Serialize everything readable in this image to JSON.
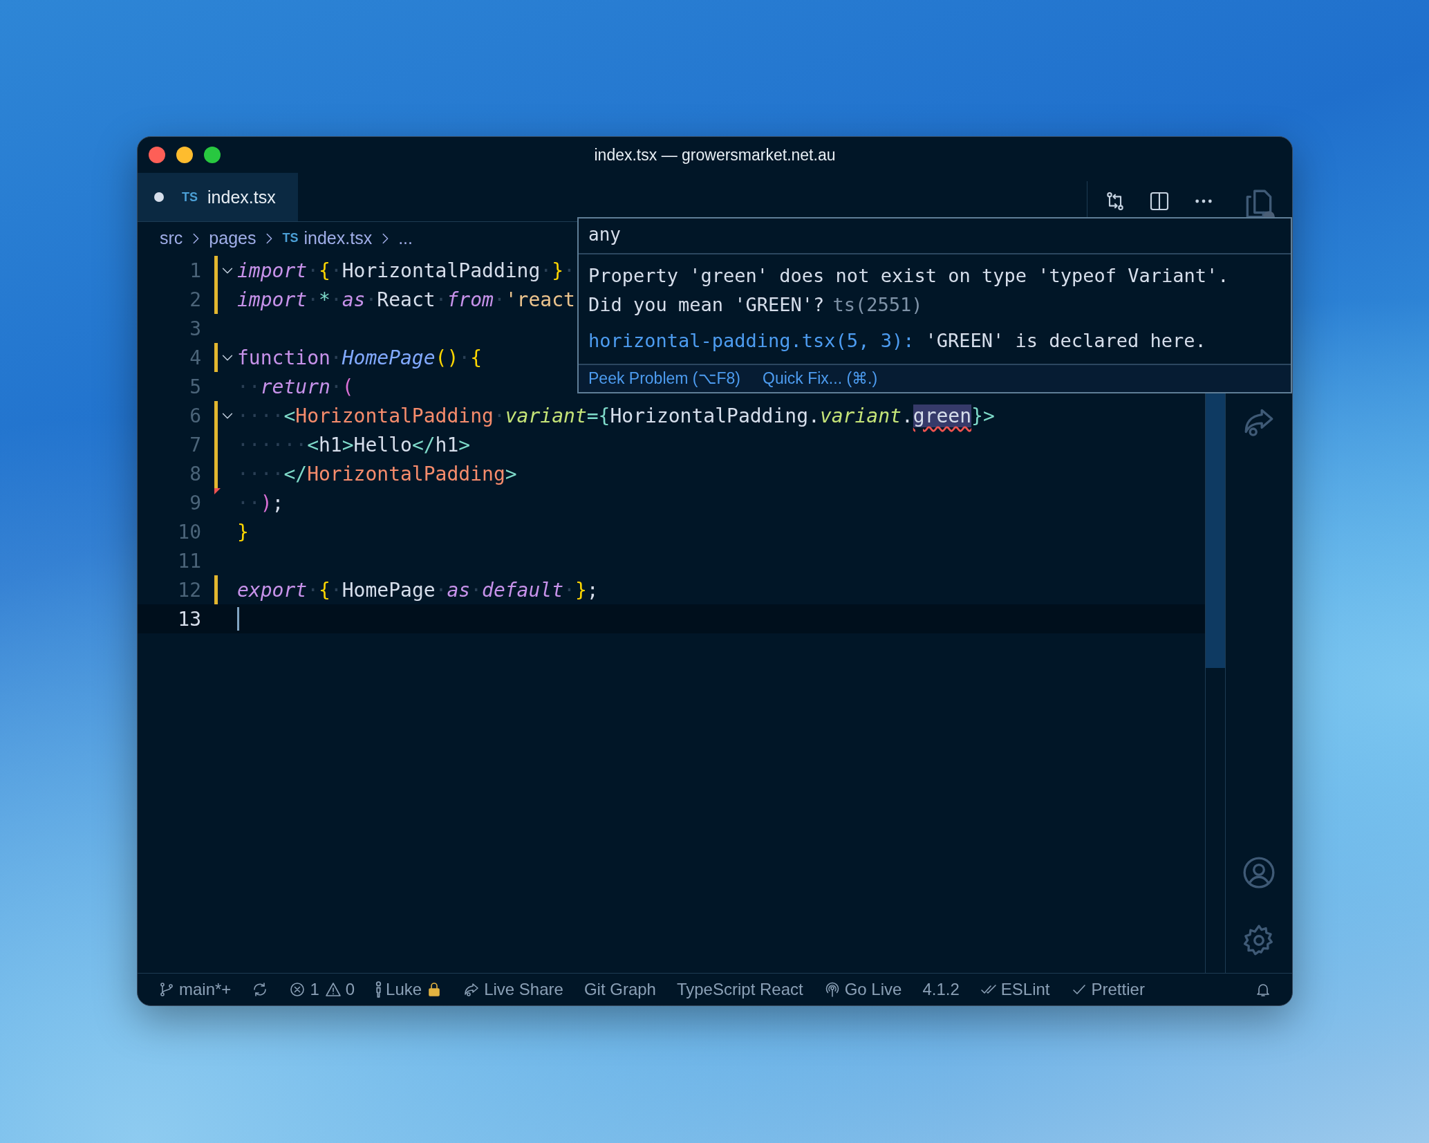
{
  "window": {
    "title": "index.tsx — growersmarket.net.au"
  },
  "tabs": [
    {
      "badge": "TS",
      "label": "index.tsx",
      "selected": true,
      "dirty": true
    }
  ],
  "breadcrumbs": [
    {
      "text": "src"
    },
    {
      "text": "pages"
    },
    {
      "badge": "TS",
      "text": "index.tsx"
    },
    {
      "text": "..."
    }
  ],
  "editor": {
    "lines": [
      {
        "number": "1",
        "modified": true,
        "deleted": false,
        "foldable": true,
        "current": false,
        "tokens": [
          {
            "kind": "kw",
            "text": "import"
          },
          {
            "kind": "ws",
            "text": "·"
          },
          {
            "kind": "brace",
            "text": "{"
          },
          {
            "kind": "ws",
            "text": "·"
          },
          {
            "kind": "ident",
            "text": "HorizontalPadding"
          },
          {
            "kind": "ws",
            "text": "·"
          },
          {
            "kind": "brace",
            "text": "}"
          },
          {
            "kind": "ws",
            "text": "·"
          }
        ]
      },
      {
        "number": "2",
        "modified": true,
        "deleted": false,
        "foldable": false,
        "current": false,
        "tokens": [
          {
            "kind": "kw",
            "text": "import"
          },
          {
            "kind": "ws",
            "text": "·"
          },
          {
            "kind": "op",
            "text": "*"
          },
          {
            "kind": "ws",
            "text": "·"
          },
          {
            "kind": "kw",
            "text": "as"
          },
          {
            "kind": "ws",
            "text": "·"
          },
          {
            "kind": "ident",
            "text": "React"
          },
          {
            "kind": "ws",
            "text": "·"
          },
          {
            "kind": "kw",
            "text": "from"
          },
          {
            "kind": "ws",
            "text": "·"
          },
          {
            "kind": "str",
            "text": "'react"
          }
        ]
      },
      {
        "number": "3",
        "modified": false,
        "deleted": false,
        "foldable": false,
        "current": false
      },
      {
        "number": "4",
        "modified": true,
        "deleted": false,
        "foldable": true,
        "current": false,
        "tokens": [
          {
            "kind": "kwp",
            "text": "function"
          },
          {
            "kind": "ws",
            "text": "·"
          },
          {
            "kind": "fn",
            "text": "HomePage"
          },
          {
            "kind": "brace",
            "text": "()"
          },
          {
            "kind": "ws",
            "text": "·"
          },
          {
            "kind": "brace",
            "text": "{"
          }
        ]
      },
      {
        "number": "5",
        "modified": false,
        "deleted": false,
        "foldable": false,
        "current": false,
        "tokens": [
          {
            "kind": "ws",
            "text": "··"
          },
          {
            "kind": "kw",
            "text": "return"
          },
          {
            "kind": "ws",
            "text": "·"
          },
          {
            "kind": "paren",
            "text": "("
          }
        ]
      },
      {
        "number": "6",
        "modified": true,
        "deleted": false,
        "foldable": true,
        "current": false,
        "tokens": [
          {
            "kind": "ws",
            "text": "····"
          },
          {
            "kind": "tagp",
            "text": "<"
          },
          {
            "kind": "tag",
            "text": "HorizontalPadding"
          },
          {
            "kind": "ws",
            "text": "·"
          },
          {
            "kind": "attr",
            "text": "variant"
          },
          {
            "kind": "tagp",
            "text": "="
          },
          {
            "kind": "op",
            "text": "{"
          },
          {
            "kind": "ident",
            "text": "HorizontalPadding"
          },
          {
            "kind": "punct",
            "text": "."
          },
          {
            "kind": "attr",
            "text": "variant"
          },
          {
            "kind": "punct",
            "text": "."
          },
          {
            "kind": "ident",
            "text": "green",
            "error": true,
            "highlighted": true
          },
          {
            "kind": "op",
            "text": "}"
          },
          {
            "kind": "tagp",
            "text": ">"
          }
        ]
      },
      {
        "number": "7",
        "modified": true,
        "deleted": false,
        "foldable": false,
        "current": false,
        "tokens": [
          {
            "kind": "ws",
            "text": "······"
          },
          {
            "kind": "tagp",
            "text": "<"
          },
          {
            "kind": "ident",
            "text": "h1"
          },
          {
            "kind": "tagp",
            "text": ">"
          },
          {
            "kind": "ident",
            "text": "Hello"
          },
          {
            "kind": "tagp",
            "text": "</"
          },
          {
            "kind": "ident",
            "text": "h1"
          },
          {
            "kind": "tagp",
            "text": ">"
          }
        ]
      },
      {
        "number": "8",
        "modified": true,
        "deleted": false,
        "foldable": false,
        "current": false,
        "tokens": [
          {
            "kind": "ws",
            "text": "····"
          },
          {
            "kind": "tagp",
            "text": "</"
          },
          {
            "kind": "tag",
            "text": "HorizontalPadding"
          },
          {
            "kind": "tagp",
            "text": ">"
          }
        ]
      },
      {
        "number": "9",
        "modified": false,
        "deleted": true,
        "foldable": false,
        "current": false,
        "tokens": [
          {
            "kind": "ws",
            "text": "··"
          },
          {
            "kind": "paren",
            "text": ")"
          },
          {
            "kind": "ident",
            "text": ";"
          }
        ]
      },
      {
        "number": "10",
        "modified": false,
        "deleted": false,
        "foldable": false,
        "current": false,
        "tokens": [
          {
            "kind": "brace",
            "text": "}"
          }
        ]
      },
      {
        "number": "11",
        "modified": false,
        "deleted": false,
        "foldable": false,
        "current": false
      },
      {
        "number": "12",
        "modified": true,
        "deleted": false,
        "foldable": false,
        "current": false,
        "tokens": [
          {
            "kind": "kw",
            "text": "export"
          },
          {
            "kind": "ws",
            "text": "·"
          },
          {
            "kind": "brace",
            "text": "{"
          },
          {
            "kind": "ws",
            "text": "·"
          },
          {
            "kind": "ident",
            "text": "HomePage"
          },
          {
            "kind": "ws",
            "text": "·"
          },
          {
            "kind": "kw",
            "text": "as"
          },
          {
            "kind": "ws",
            "text": "·"
          },
          {
            "kind": "kw",
            "text": "default"
          },
          {
            "kind": "ws",
            "text": "·"
          },
          {
            "kind": "brace",
            "text": "}"
          },
          {
            "kind": "ident",
            "text": ";"
          }
        ]
      },
      {
        "number": "13",
        "modified": false,
        "deleted": false,
        "foldable": false,
        "current": true
      }
    ]
  },
  "hover": {
    "type": "any",
    "message": [
      "Property 'green' does not exist on type 'typeof Variant'.",
      "Did you mean 'GREEN'?"
    ],
    "code": "ts(2551)",
    "related_link": "horizontal-padding.tsx(5, 3):",
    "related_text": "'GREEN' is declared here.",
    "actions": [
      "Peek Problem (⌥F8)",
      "Quick Fix... (⌘.)"
    ]
  },
  "status_bar": [
    {
      "kind": "branch",
      "text": "main*+"
    },
    {
      "kind": "sync"
    },
    {
      "kind": "error",
      "text": "1"
    },
    {
      "kind": "warning",
      "text": "0"
    },
    {
      "kind": "person",
      "text": "Luke",
      "locked": true
    },
    {
      "kind": "liveshare",
      "text": "Live Share"
    },
    {
      "kind": "plain",
      "text": "Git Graph"
    },
    {
      "kind": "plain",
      "text": "TypeScript React"
    },
    {
      "kind": "broadcast",
      "text": "Go Live"
    },
    {
      "kind": "plain",
      "text": "4.1.2"
    },
    {
      "kind": "checks",
      "text": "ESLint"
    },
    {
      "kind": "check",
      "text": "Prettier"
    },
    {
      "kind": "bell"
    }
  ]
}
